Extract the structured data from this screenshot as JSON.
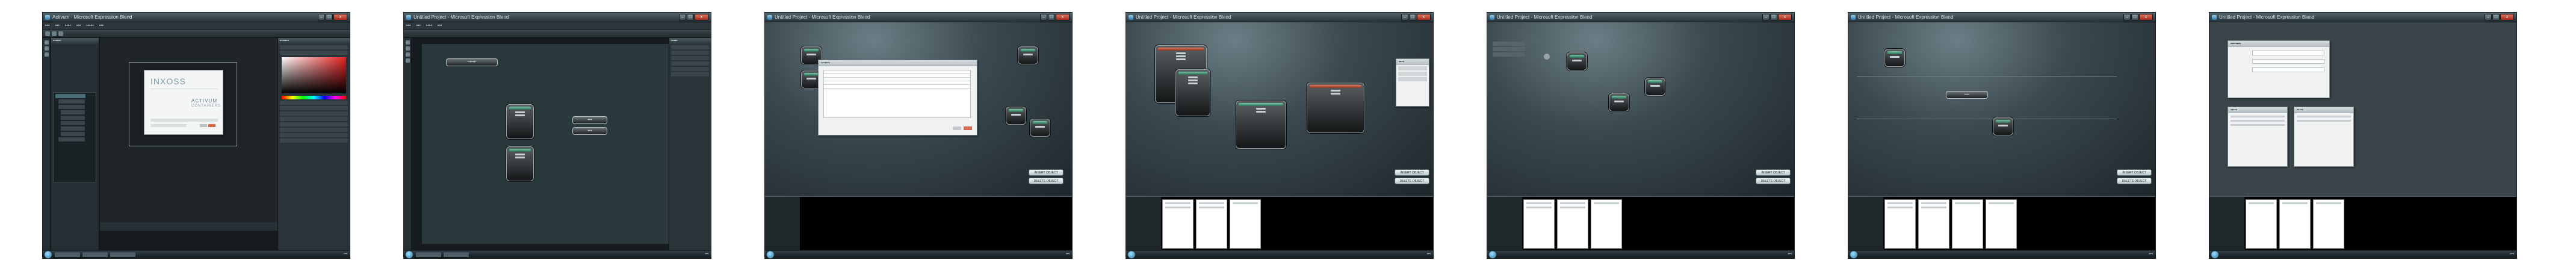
{
  "screens": [
    {
      "title": "Activum · Microsoft Expression Blend"
    },
    {
      "title": "Untitled Project - Microsoft Expression Blend"
    },
    {
      "title": "Untitled Project - Microsoft Expression Blend"
    },
    {
      "title": "Untitled Project - Microsoft Expression Blend"
    },
    {
      "title": "Untitled Project - Microsoft Expression Blend"
    },
    {
      "title": "Untitled Project - Microsoft Expression Blend"
    },
    {
      "title": "Untitled Project - Microsoft Expression Blend"
    }
  ],
  "splash": {
    "brand": "INXOSS",
    "product": "ACTIVUM",
    "tagline": "CONTAINERS"
  },
  "buttons": {
    "insert": "INSERT OBJECT",
    "delete": "DELETE OBJECT"
  },
  "colors": {
    "canvas": "#3b4a50",
    "accent_green": "#74c6a6",
    "titlebar": "#27333a",
    "panel": "#2a3337"
  }
}
